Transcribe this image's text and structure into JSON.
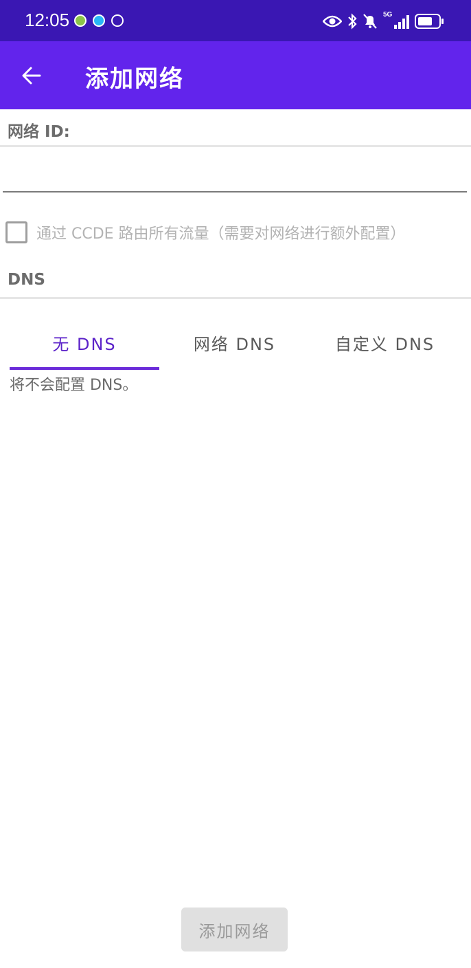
{
  "status_bar": {
    "time": "12:05",
    "notification_icons": [
      "wechat-icon",
      "app-notification-icon",
      "data-saver-icon"
    ],
    "right_icons": [
      "eye-icon",
      "bluetooth-icon",
      "mute-icon",
      "signal-5g-icon",
      "battery-icon"
    ],
    "network_badge": "5G",
    "color": "#3a17b3"
  },
  "app_bar": {
    "back_icon": "arrow-left-icon",
    "title": "添加网络",
    "color": "#6224ec"
  },
  "form": {
    "network_id_label": "网络 ID:",
    "network_id_value": "",
    "route_all_traffic": {
      "checked": false,
      "label": "通过 CCDE 路由所有流量（需要对网络进行额外配置）"
    },
    "dns_label": "DNS"
  },
  "dns_tabs": {
    "tabs": [
      {
        "label": "无 DNS",
        "active": true
      },
      {
        "label": "网络 DNS",
        "active": false
      },
      {
        "label": "自定义 DNS",
        "active": false
      }
    ],
    "accent_color": "#6a2bd9",
    "description": "将不会配置 DNS。"
  },
  "footer": {
    "add_button_label": "添加网络",
    "add_button_enabled": false
  }
}
